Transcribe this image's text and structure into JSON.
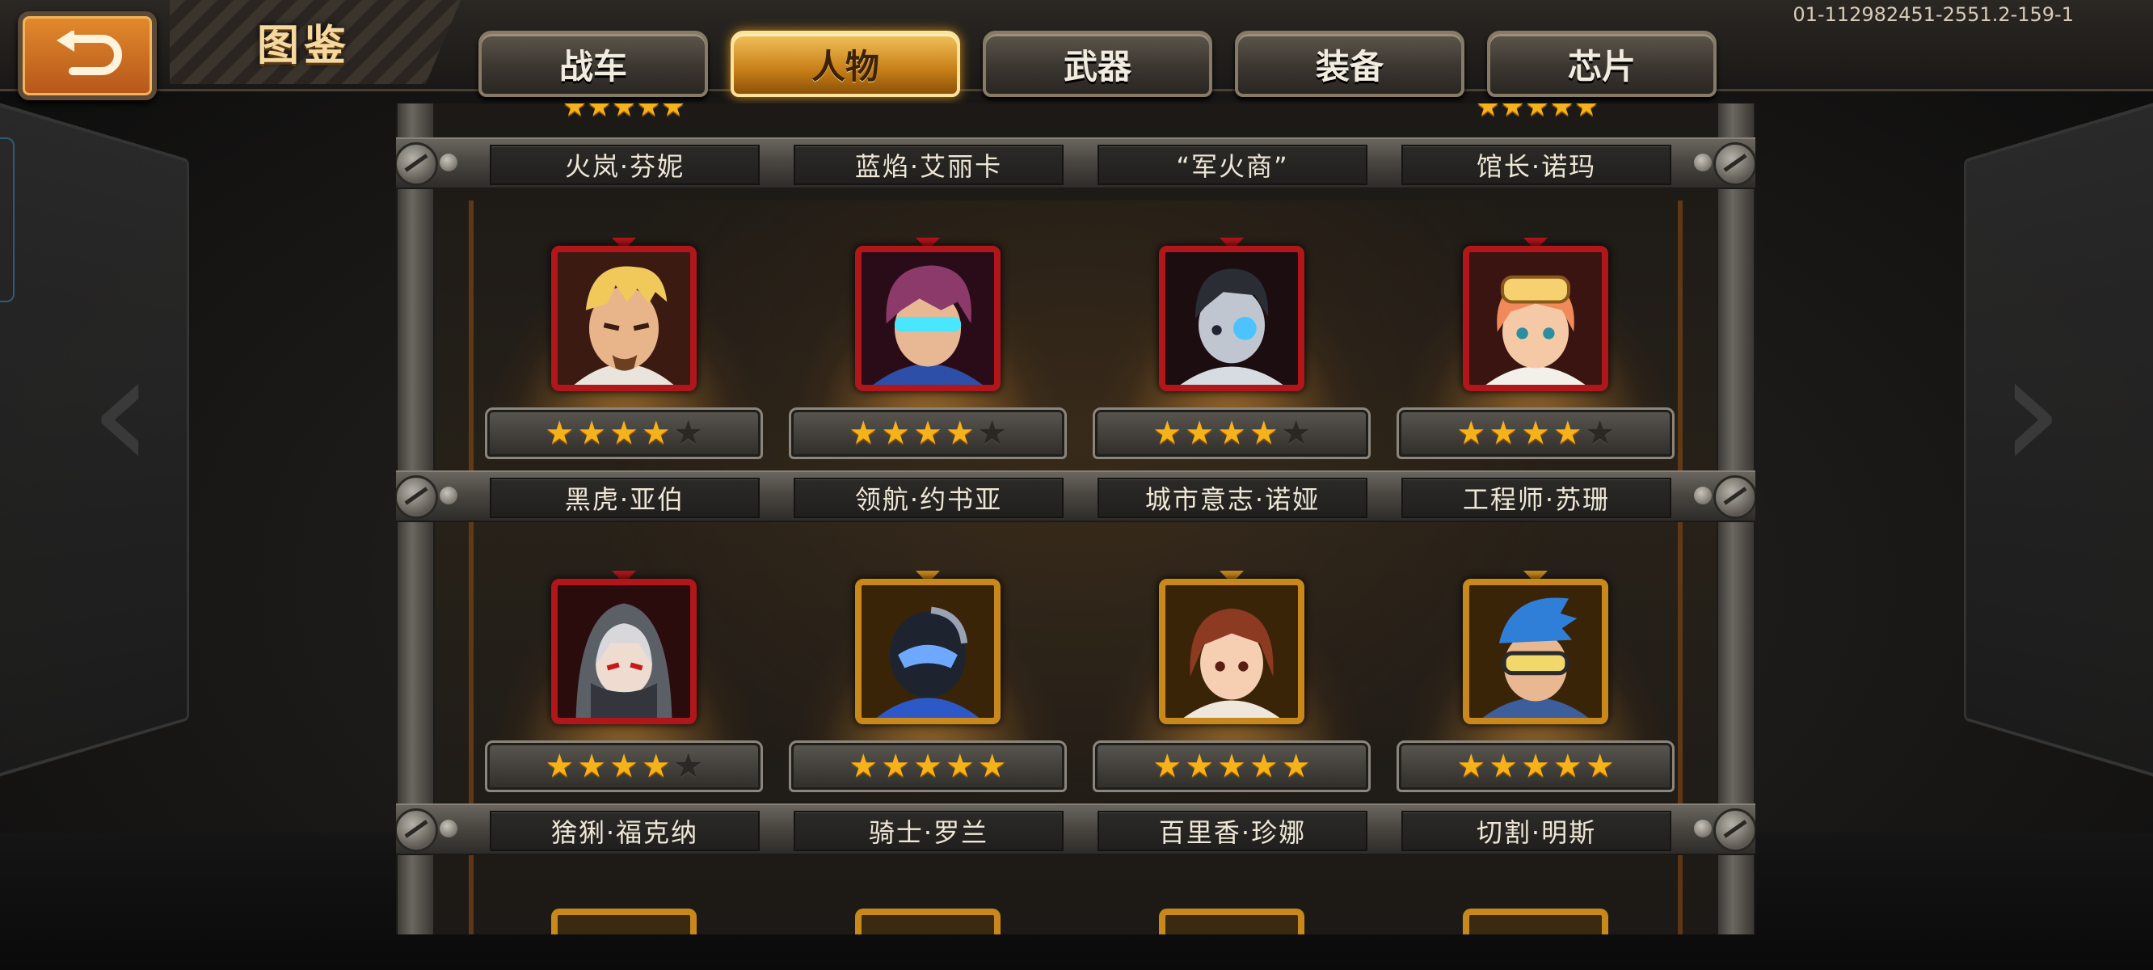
{
  "header": {
    "title": "图鉴",
    "build_id": "01-112982451-2551.2-159-1",
    "back_label": "back"
  },
  "tabs": [
    {
      "label": "战车",
      "active": false
    },
    {
      "label": "人物",
      "active": true
    },
    {
      "label": "武器",
      "active": false
    },
    {
      "label": "装备",
      "active": false
    },
    {
      "label": "芯片",
      "active": false
    }
  ],
  "rows": [
    {
      "names": [
        "火岚·芬妮",
        "蓝焰·艾丽卡",
        "“军火商”",
        "馆长·诺玛"
      ]
    },
    {
      "names": [
        "黑虎·亚伯",
        "领航·约书亚",
        "城市意志·诺娅",
        "工程师·苏珊"
      ],
      "characters": [
        {
          "name": "黑虎·亚伯",
          "stars": 4,
          "max_stars": 5,
          "frame": "red",
          "icon": "portrait-blond-man"
        },
        {
          "name": "领航·约书亚",
          "stars": 4,
          "max_stars": 5,
          "frame": "red",
          "icon": "portrait-visor-man"
        },
        {
          "name": "城市意志·诺娅",
          "stars": 4,
          "max_stars": 5,
          "frame": "red",
          "icon": "portrait-android-girl"
        },
        {
          "name": "工程师·苏珊",
          "stars": 4,
          "max_stars": 5,
          "frame": "red",
          "icon": "portrait-goggles-girl"
        }
      ]
    },
    {
      "names": [
        "猞猁·福克纳",
        "骑士·罗兰",
        "百里香·珍娜",
        "切割·明斯"
      ],
      "characters": [
        {
          "name": "猞猁·福克纳",
          "stars": 4,
          "max_stars": 5,
          "frame": "red",
          "icon": "portrait-hooded-man"
        },
        {
          "name": "骑士·罗兰",
          "stars": 5,
          "max_stars": 5,
          "frame": "gold",
          "icon": "portrait-armored-knight"
        },
        {
          "name": "百里香·珍娜",
          "stars": 5,
          "max_stars": 5,
          "frame": "gold",
          "icon": "portrait-brown-hair-girl"
        },
        {
          "name": "切割·明斯",
          "stars": 5,
          "max_stars": 5,
          "frame": "gold",
          "icon": "portrait-blue-mohawk"
        }
      ]
    }
  ],
  "colors": {
    "accent_orange": "#d9782a",
    "frame_red": "#b0161a",
    "frame_gold": "#c9881c",
    "star_on": "#f6b21b"
  }
}
